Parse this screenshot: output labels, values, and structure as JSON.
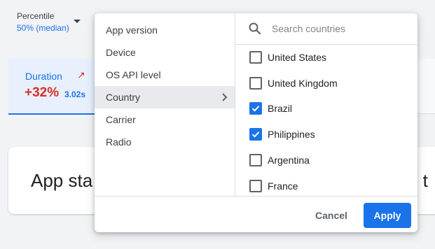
{
  "percentile": {
    "label": "Percentile",
    "value": "50% (median)"
  },
  "metric_card": {
    "title": "Duration",
    "delta": "+32%",
    "value": "3.02s"
  },
  "bottom_card": {
    "left_text": "App sta",
    "right_text": "d t"
  },
  "dropdown": {
    "menu": [
      {
        "label": "App version",
        "active": false
      },
      {
        "label": "Device",
        "active": false
      },
      {
        "label": "OS API level",
        "active": false
      },
      {
        "label": "Country",
        "active": true
      },
      {
        "label": "Carrier",
        "active": false
      },
      {
        "label": "Radio",
        "active": false
      }
    ],
    "search": {
      "placeholder": "Search countries",
      "value": ""
    },
    "countries": [
      {
        "name": "United States",
        "checked": false
      },
      {
        "name": "United Kingdom",
        "checked": false
      },
      {
        "name": "Brazil",
        "checked": true
      },
      {
        "name": "Philippines",
        "checked": true
      },
      {
        "name": "Argentina",
        "checked": false
      },
      {
        "name": "France",
        "checked": false
      }
    ],
    "cancel_label": "Cancel",
    "apply_label": "Apply"
  },
  "colors": {
    "accent": "#1a73e8",
    "negative": "#d93025",
    "menu_active": "#e8eaed"
  },
  "icons": {
    "dropdown": "caret-down-icon",
    "trend": "trend-up-arrow-icon",
    "search": "search-icon",
    "submenu": "chevron-right-icon",
    "check": "checkmark-icon"
  }
}
